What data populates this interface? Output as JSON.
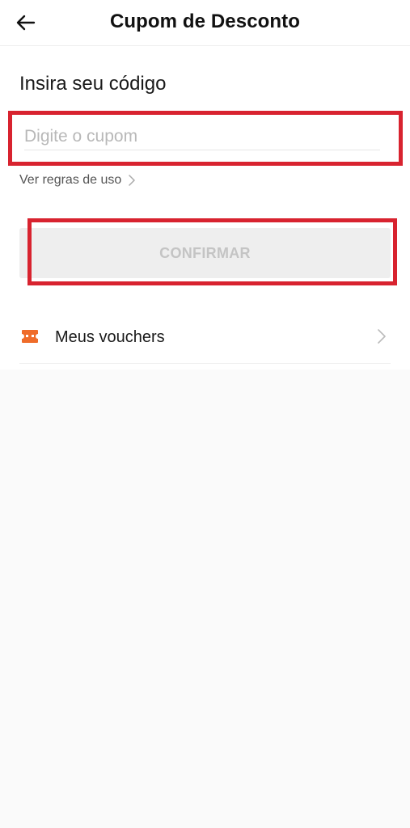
{
  "header": {
    "title": "Cupom de Desconto",
    "back_icon": "arrow-left-icon"
  },
  "coupon": {
    "section_title": "Insira seu código",
    "input_placeholder": "Digite o cupom",
    "input_value": "",
    "rules_link": "Ver regras de uso",
    "confirm_label": "CONFIRMAR"
  },
  "vouchers": {
    "label": "Meus vouchers",
    "icon": "ticket-icon"
  },
  "colors": {
    "highlight": "#d8232f",
    "voucher_icon": "#ef6c2a",
    "button_disabled_bg": "#eeeeee",
    "button_disabled_text": "#c4c4c4"
  }
}
